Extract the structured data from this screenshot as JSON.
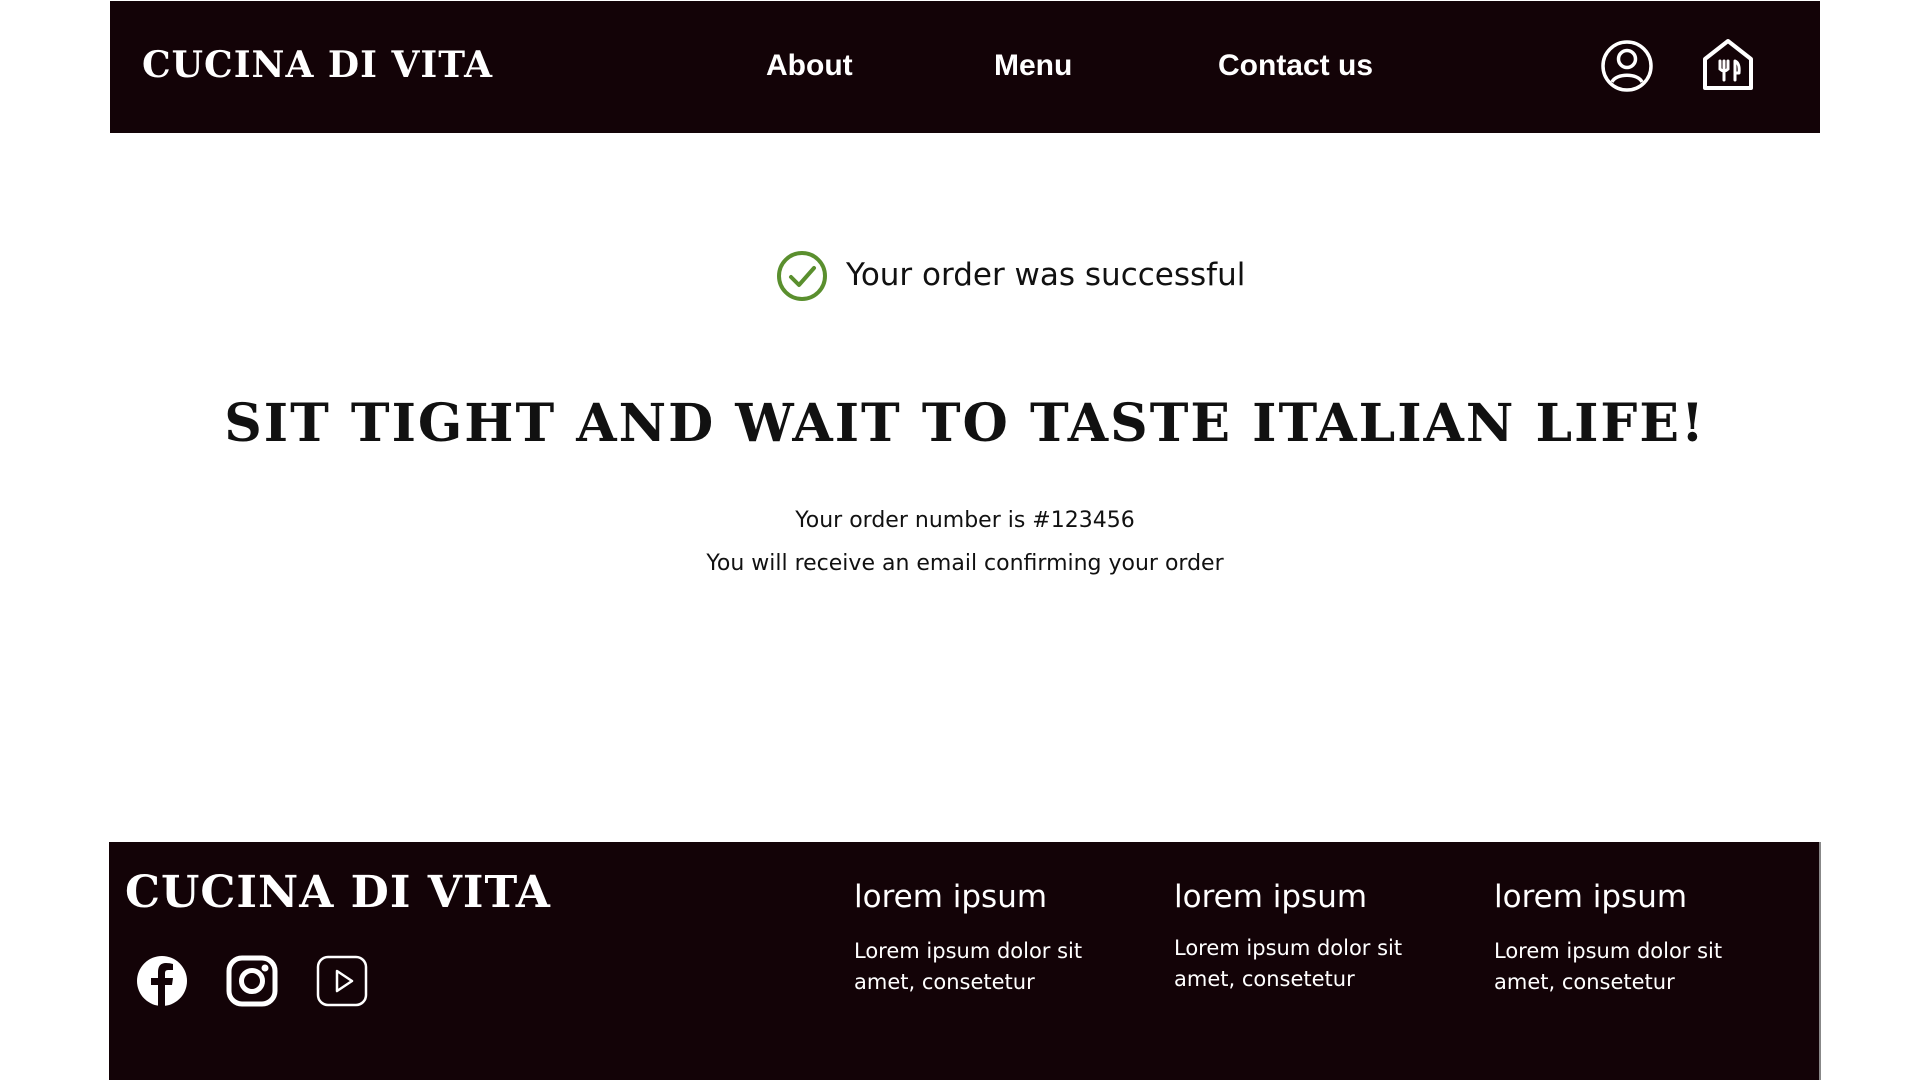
{
  "header": {
    "brand": "CUCINA DI VITA",
    "nav": {
      "about": "About",
      "menu": "Menu",
      "contact": "Contact us"
    },
    "icons": [
      "account-icon",
      "restaurant-order-icon"
    ]
  },
  "main": {
    "status": "Your order was successful",
    "headline": "SIT TIGHT AND WAIT TO TASTE ITALIAN LIFE!",
    "order_number_text": "Your order number is #123456",
    "email_text": "You will receive an email confirming your order"
  },
  "footer": {
    "brand": "CUCINA DI VITA",
    "social_icons": [
      "facebook-icon",
      "instagram-icon",
      "youtube-icon"
    ],
    "columns": [
      {
        "title": "lorem ipsum",
        "text": "Lorem ipsum dolor sit amet, consetetur"
      },
      {
        "title": "lorem ipsum",
        "text": "Lorem ipsum dolor sit amet, consetetur"
      },
      {
        "title": "lorem ipsum",
        "text": "Lorem ipsum dolor sit amet, consetetur"
      }
    ]
  },
  "colors": {
    "dark_background": "#130307",
    "success_green": "#5a8f2e",
    "text": "#111111",
    "white": "#ffffff"
  }
}
